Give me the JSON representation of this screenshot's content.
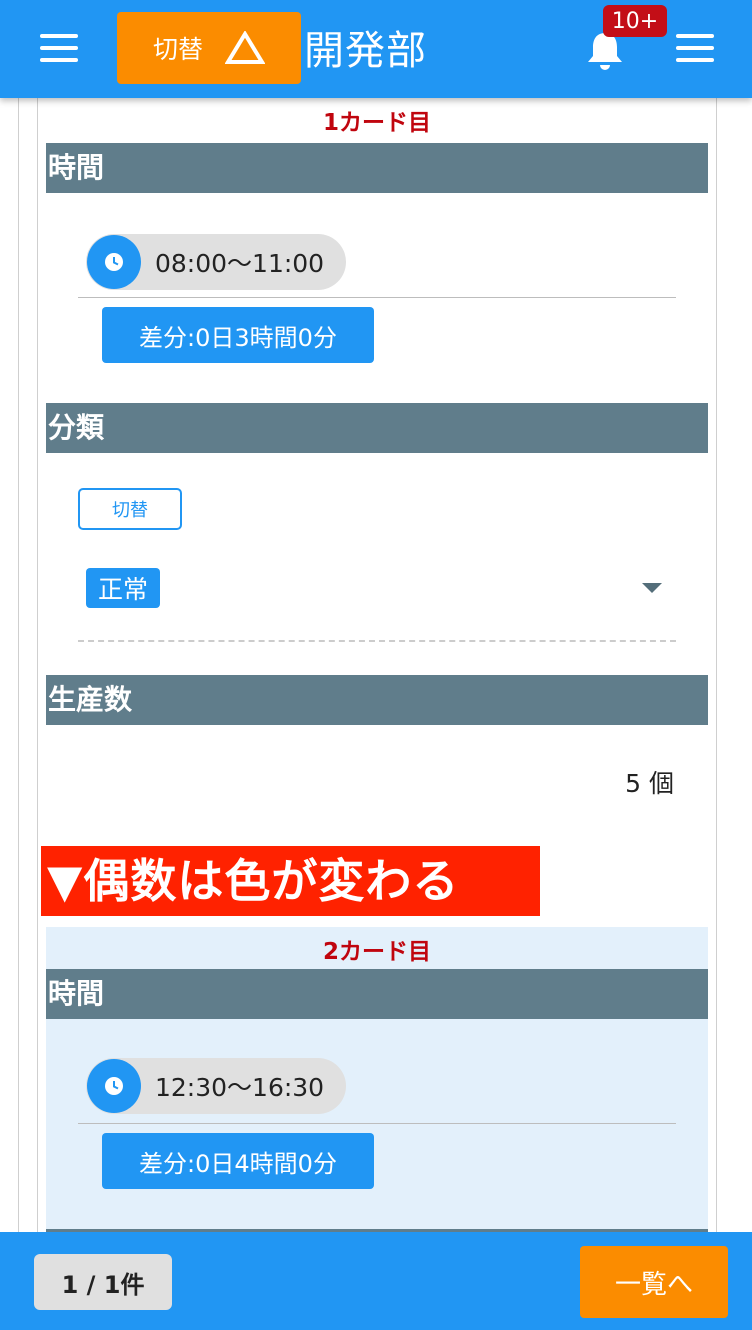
{
  "header": {
    "switch_label": "切替",
    "dept_title": "開発部",
    "notification_badge": "10+"
  },
  "cards": [
    {
      "label": "1カード目",
      "time_header": "時間",
      "time_range": "08:00〜11:00",
      "diff": "差分:0日3時間0分",
      "category_header": "分類",
      "toggle_label": "切替",
      "category_value": "正常",
      "production_header": "生産数",
      "production_value": "5 個"
    },
    {
      "label": "2カード目",
      "time_header": "時間",
      "time_range": "12:30〜16:30",
      "diff": "差分:0日4時間0分"
    }
  ],
  "callout": "▼偶数は色が変わる",
  "footer": {
    "page_count": "1 / 1件",
    "list_button": "一覧へ"
  },
  "colors": {
    "primary": "#2196f3",
    "accent": "#fb8c00",
    "section_header": "#607d8b",
    "badge": "#c30e17",
    "callout": "#ff2200",
    "even_card": "#e3f0fb"
  }
}
